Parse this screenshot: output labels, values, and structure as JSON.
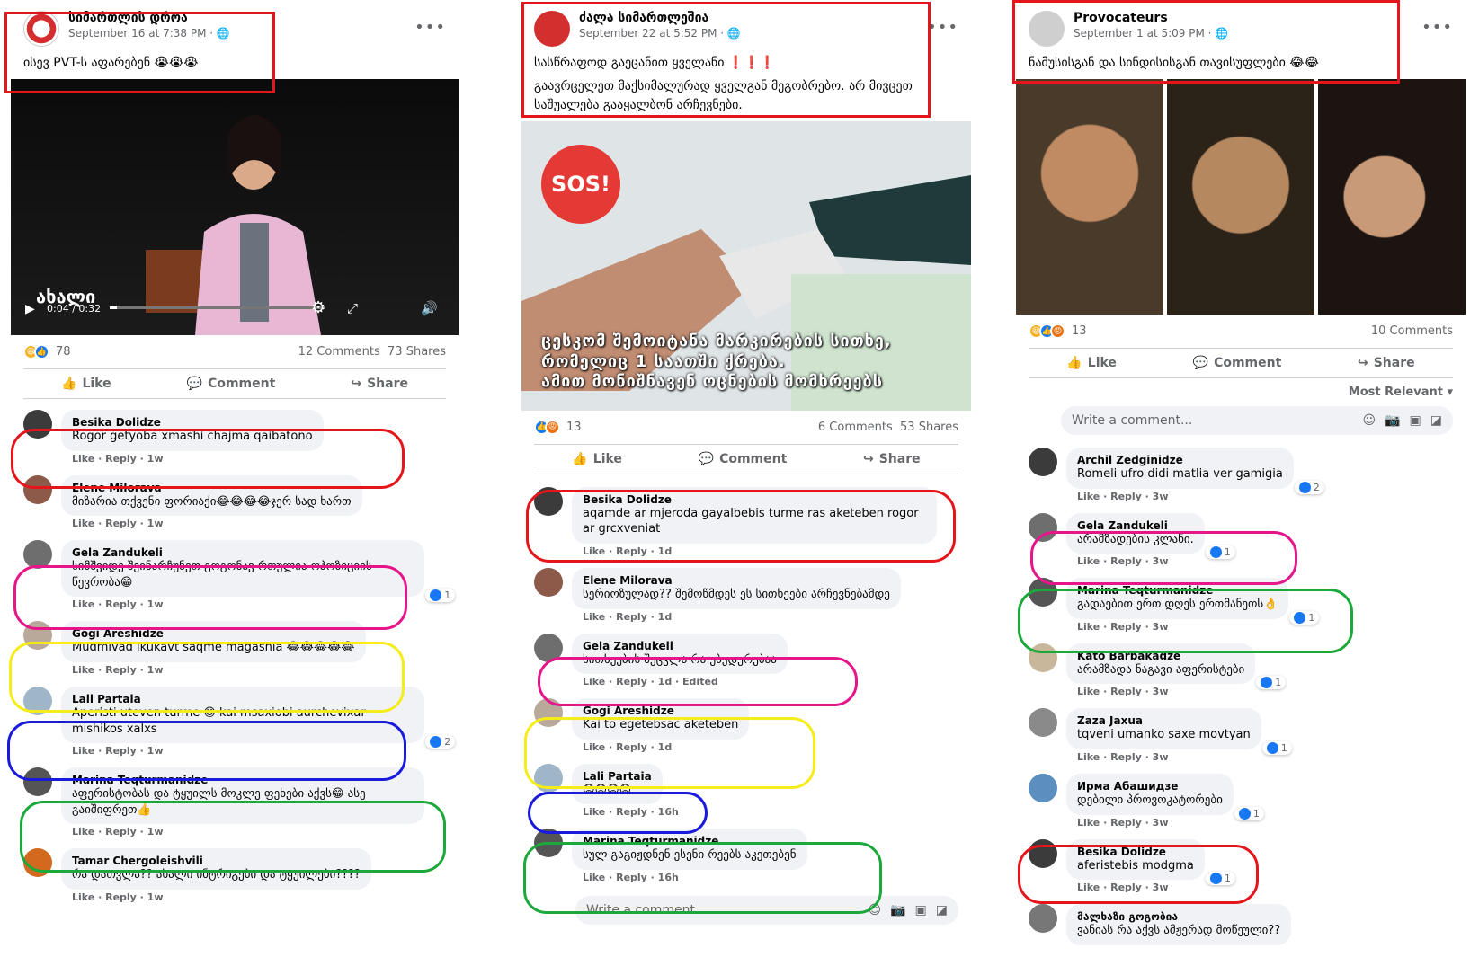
{
  "col1": {
    "page_name": "სიმართლის დროა",
    "time": "September 16 at 7:38 PM · ",
    "post_text": "ისევ PVT-ს აფარებენ 😭😭😭",
    "video_brand": "ახალი",
    "video_time": "0:04 / 0:32",
    "reaction_count": "78",
    "comments_count": "12 Comments",
    "shares_count": "73 Shares",
    "like_label": "Like",
    "comment_label": "Comment",
    "share_label": "Share",
    "comments": [
      {
        "name": "Besika Dolidze",
        "text": "Rogor getyoba xmashi chajma qaibatono",
        "meta": "Like · Reply · 1w",
        "likes": ""
      },
      {
        "name": "Elene Milorava",
        "text": "მიზარია თქვენი ფორიაქი😂😂😂😂ჯერ სად ხართ",
        "meta": "Like · Reply · 1w",
        "likes": ""
      },
      {
        "name": "Gela Zandukeli",
        "text": "სიმშვიდე შეინარჩუნეთ გოგონავ რთულია ოპოზიციის წევრობა😁",
        "meta": "Like · Reply · 1w",
        "likes": "1"
      },
      {
        "name": "Gogi Areshidze",
        "text": "Mudmivad ikukavt saqme magashia 😂😂😂😂😂",
        "meta": "Like · Reply · 1w",
        "likes": ""
      },
      {
        "name": "Lali Partaia",
        "text": "Aperisti uteven turme 😊 kai msaxiobi aurchevixar mishikos xalxs",
        "meta": "Like · Reply · 1w",
        "likes": "2"
      },
      {
        "name": "Marina Teqturmanidze",
        "text": "აფერისტობას და ტყუილს მოკლე ფეხები აქვს😁 ასე გაიშიფრეთ👍",
        "meta": "Like · Reply · 1w",
        "likes": ""
      },
      {
        "name": "Tamar Chergoleishvili",
        "text": "რა დათვლა?? ახალი ინტრიგები და ტყუილები????",
        "meta": "Like · Reply · 1w",
        "likes": ""
      }
    ]
  },
  "col2": {
    "page_name": "ძალა სიმართლეშია",
    "time": "September 22 at 5:52 PM · ",
    "post_text_1": "სასწრაფოდ გაეცანით ყველანი ❗❗❗",
    "post_text_2": "გაავრცელეთ მაქსიმალურად ყველგან მეგობრებო. არ მივცეთ საშუალება გააყალბონ არჩევნები.",
    "sos": "SOS!",
    "overlay_1": "ცესკომ შემოიტანა მარკირების სითხე,",
    "overlay_2": "რომელიც 1 საათში ქრება.",
    "overlay_3": "ამით მონიშნავენ ოცნების მომხრეებს",
    "reaction_count": "13",
    "comments_count": "6 Comments",
    "shares_count": "53 Shares",
    "like_label": "Like",
    "comment_label": "Comment",
    "share_label": "Share",
    "write_placeholder": "Write a comment...",
    "comments": [
      {
        "name": "Besika Dolidze",
        "text": "aqamde ar mjeroda gayalbebis turme ras aketeben rogor ar grcxveniat",
        "meta": "Like · Reply · 1d",
        "likes": ""
      },
      {
        "name": "Elene Milorava",
        "text": "სერიოზულად?? შემოწმდეს ეს სითხეები არჩევნებამდე",
        "meta": "Like · Reply · 1d",
        "likes": ""
      },
      {
        "name": "Gela Zandukeli",
        "text": "სითხეების შეცვლა რა უბედურებაა",
        "meta": "Like · Reply · 1d · Edited",
        "likes": ""
      },
      {
        "name": "Gogi Areshidze",
        "text": "Kai to egetebsac aketeben",
        "meta": "Like · Reply · 1d",
        "likes": ""
      },
      {
        "name": "Lali Partaia",
        "text": "😡😡😡😡",
        "meta": "Like · Reply · 16h",
        "likes": ""
      },
      {
        "name": "Marina Teqturmanidze",
        "text": "სულ გაგიჟდნენ ესენი რეებს აკეთებენ",
        "meta": "Like · Reply · 16h",
        "likes": ""
      }
    ]
  },
  "col3": {
    "page_name": "Provocateurs",
    "time": "September 1 at 5:09 PM · ",
    "post_text": "ნამუსისგან და სინდისისგან თავისუფლები 😂😂",
    "reaction_count": "13",
    "comments_count": "10 Comments",
    "like_label": "Like",
    "comment_label": "Comment",
    "share_label": "Share",
    "sort_label": "Most Relevant ▾",
    "write_placeholder": "Write a comment...",
    "comments": [
      {
        "name": "Archil Zedginidze",
        "text": "Romeli ufro didi matlia ver gamigia",
        "meta": "Like · Reply · 3w",
        "likes": "2"
      },
      {
        "name": "Gela Zandukeli",
        "text": "არამზადების კლანი.",
        "meta": "Like · Reply · 3w",
        "likes": "1"
      },
      {
        "name": "Marina Teqturmanidze",
        "text": "გადაებით ერთ დღეს ერთმანეთს👌",
        "meta": "Like · Reply · 3w",
        "likes": "1"
      },
      {
        "name": "Kato Barbakadze",
        "text": "არამზადა ნაგავი აფერისტები",
        "meta": "Like · Reply · 3w",
        "likes": "1"
      },
      {
        "name": "Zaza Jaxua",
        "text": "tqveni umanko saxe movtyan",
        "meta": "Like · Reply · 3w",
        "likes": "1"
      },
      {
        "name": "Ирма Абашидзе",
        "text": "დებილი პროვოკატორები",
        "meta": "Like · Reply · 3w",
        "likes": "1"
      },
      {
        "name": "Besika Dolidze",
        "text": "aferistebis modgma",
        "meta": "Like · Reply · 3w",
        "likes": "1"
      },
      {
        "name": "მალხაზი გოგობია",
        "text": "ვანიას რა აქვს ამჟერად მოწეული??",
        "meta": "",
        "likes": ""
      }
    ]
  },
  "colors": {
    "red": "#e4161c",
    "magenta": "#e6168a",
    "yellow": "#f6ec1a",
    "blue": "#1a1adc",
    "green": "#1ca83a",
    "fb_blue": "#1877f2"
  }
}
